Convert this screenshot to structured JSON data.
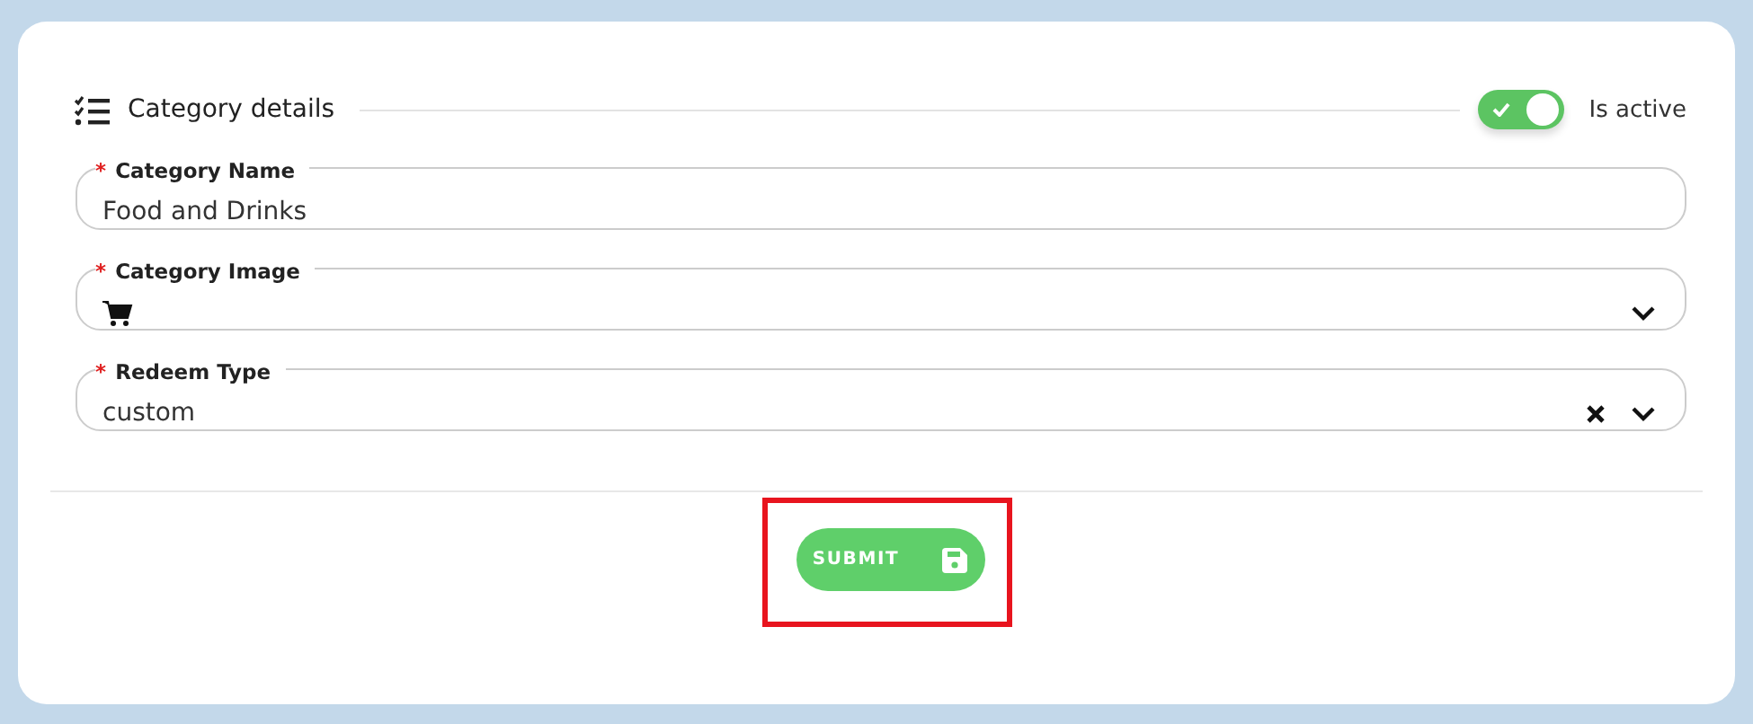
{
  "section": {
    "title": "Category details"
  },
  "active_toggle": {
    "label": "Is active",
    "on": true
  },
  "fields": [
    {
      "kind": "text",
      "required_mark": "*",
      "label": "Category Name",
      "value": "Food and Drinks"
    },
    {
      "kind": "icon-select",
      "required_mark": "*",
      "label": "Category Image"
    },
    {
      "kind": "clearable-select",
      "required_mark": "*",
      "label": "Redeem Type",
      "value": "custom"
    }
  ],
  "submit": {
    "label": "SUBMIT"
  }
}
